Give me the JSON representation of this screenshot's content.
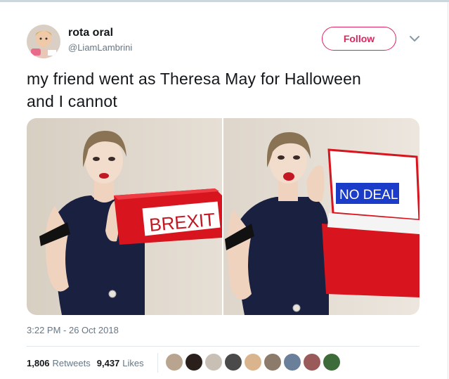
{
  "author": {
    "name": "rota oral",
    "handle": "@LiamLambrini"
  },
  "follow": {
    "label": "Follow"
  },
  "tweet": {
    "text_line1": "my friend went as Theresa May for Halloween",
    "text_line2": "and I cannot"
  },
  "media": {
    "left_sign": "BREXIT",
    "right_sign": "NO DEAL"
  },
  "meta": {
    "timestamp": "3:22 PM - 26 Oct 2018"
  },
  "stats": {
    "retweets_count": "1,806",
    "retweets_label": "Retweets",
    "likes_count": "9,437",
    "likes_label": "Likes"
  },
  "colors": {
    "accent": "#e0245e",
    "secondary_text": "#657786",
    "dress": "#1a2140",
    "box_red": "#d8141e",
    "sign_blue": "#1a3cc8"
  },
  "likers": [
    "liker-avatar",
    "liker-avatar",
    "liker-avatar",
    "liker-avatar",
    "liker-avatar",
    "liker-avatar",
    "liker-avatar",
    "liker-avatar",
    "liker-avatar",
    "liker-avatar"
  ]
}
